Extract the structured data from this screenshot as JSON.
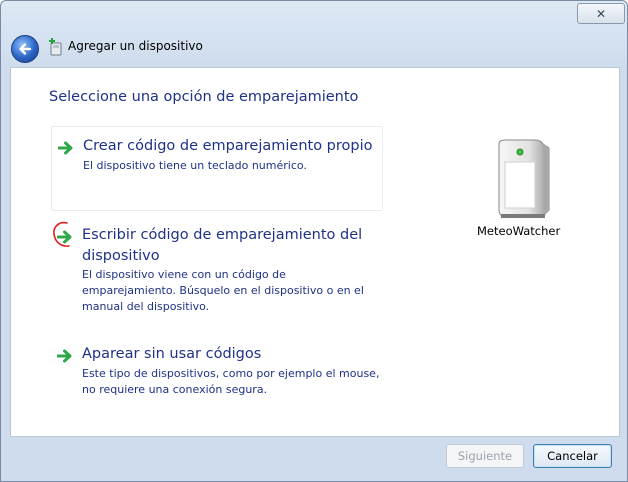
{
  "window": {
    "title": "Agregar un dispositivo",
    "close_glyph": "✕"
  },
  "page": {
    "heading": "Seleccione una opción de emparejamiento"
  },
  "options": [
    {
      "title": "Crear código de emparejamiento propio",
      "description": "El dispositivo tiene un teclado numérico.",
      "icon": "green-arrow-icon"
    },
    {
      "title": "Escribir código de emparejamiento del dispositivo",
      "description": "El dispositivo viene con un código de emparejamiento. Búsquelo en el dispositivo o en el manual del dispositivo.",
      "icon": "green-arrow-icon"
    },
    {
      "title": "Aparear sin usar códigos",
      "description": "Este tipo de dispositivos, como por ejemplo el mouse, no requiere una conexión segura.",
      "icon": "green-arrow-icon"
    }
  ],
  "device": {
    "name": "MeteoWatcher",
    "icon": "device-tower-icon"
  },
  "footer": {
    "next_label": "Siguiente",
    "next_enabled": false,
    "cancel_label": "Cancelar"
  },
  "colors": {
    "link_blue": "#1e3287",
    "arrow_green": "#2ea84a",
    "annotation_red": "#e02020"
  }
}
